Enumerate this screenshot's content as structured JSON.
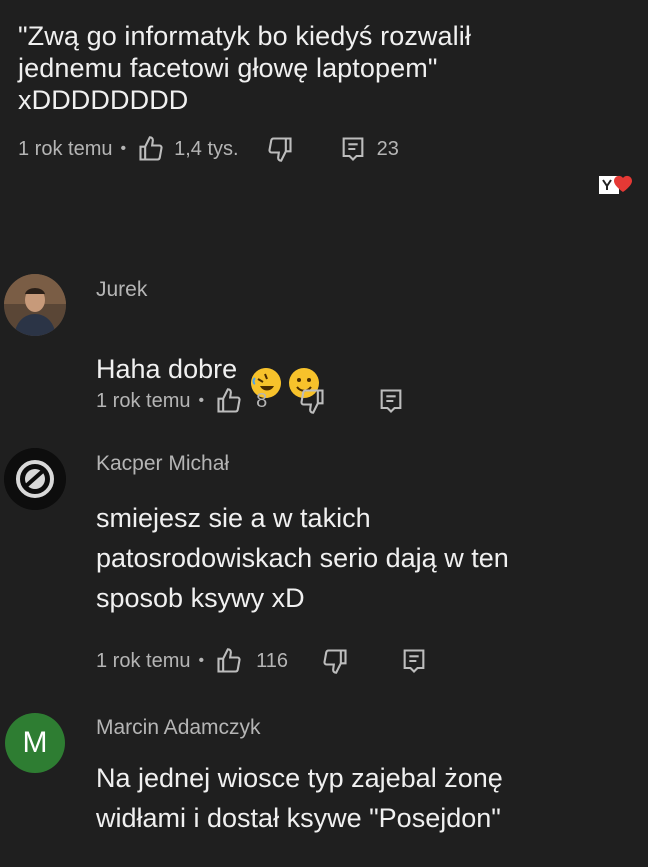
{
  "top_comment": {
    "text": "\"Zwą go informatyk bo kiedyś rozwalił\njednemu facetowi głowę laptopem\"\nxDDDDDDDD",
    "time": "1 rok temu",
    "likes": "1,4 tys.",
    "replies": "23"
  },
  "replies": [
    {
      "author": "Jurek",
      "text": "Haha dobre",
      "emojis": [
        "rolling-on-floor-laughing",
        "slightly-smiling-face"
      ],
      "time": "1 rok temu",
      "likes": "8",
      "avatar_icon": "photo-avatar"
    },
    {
      "author": "Kacper Michał",
      "text": "smiejesz sie a w takich\npatosrodowiskach serio dają w ten\nsposob ksywy xD",
      "time": "1 rok temu",
      "likes": "116",
      "avatar_icon": "circle-logo-avatar"
    },
    {
      "author": "Marcin Adamczyk",
      "text": "Na jednej wiosce typ zajebal żonę\nwidłami i dostał ksywe \"Posejdon\"",
      "avatar_letter": "M",
      "avatar_color": "#2e7d32"
    }
  ],
  "colors": {
    "background": "#1f1f1f",
    "text": "#f0f0f0",
    "meta": "#b5b5b5",
    "heart": "#e53935"
  }
}
